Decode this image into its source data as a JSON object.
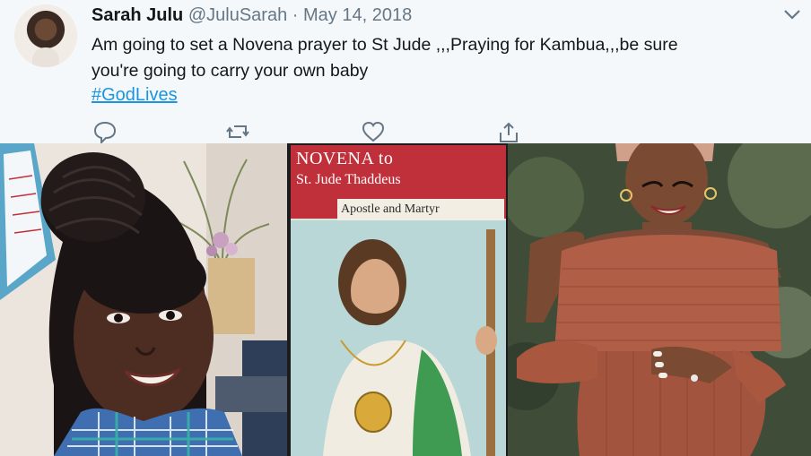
{
  "tweet": {
    "author_name": "Sarah Julu",
    "handle": "@JuluSarah",
    "separator": "·",
    "date": "May 14, 2018",
    "text_line_1": "Am going to set a Novena prayer to St Jude ,,,Praying for Kambua,,,be sure",
    "text_line_2": "you're going to carry your own baby",
    "hashtag": "#GodLives"
  },
  "actions": [
    {
      "icon": "reply-icon"
    },
    {
      "icon": "retweet-icon"
    },
    {
      "icon": "like-icon"
    },
    {
      "icon": "share-icon"
    }
  ],
  "media": {
    "book_title": "NOVENA to",
    "book_subtitle": "St. Jude Thaddeus",
    "book_banner": "Apostle and Martyr"
  },
  "colors": {
    "link": "#1b95e0",
    "muted": "#657786",
    "text": "#14171a",
    "book_red": "#c0303a"
  }
}
